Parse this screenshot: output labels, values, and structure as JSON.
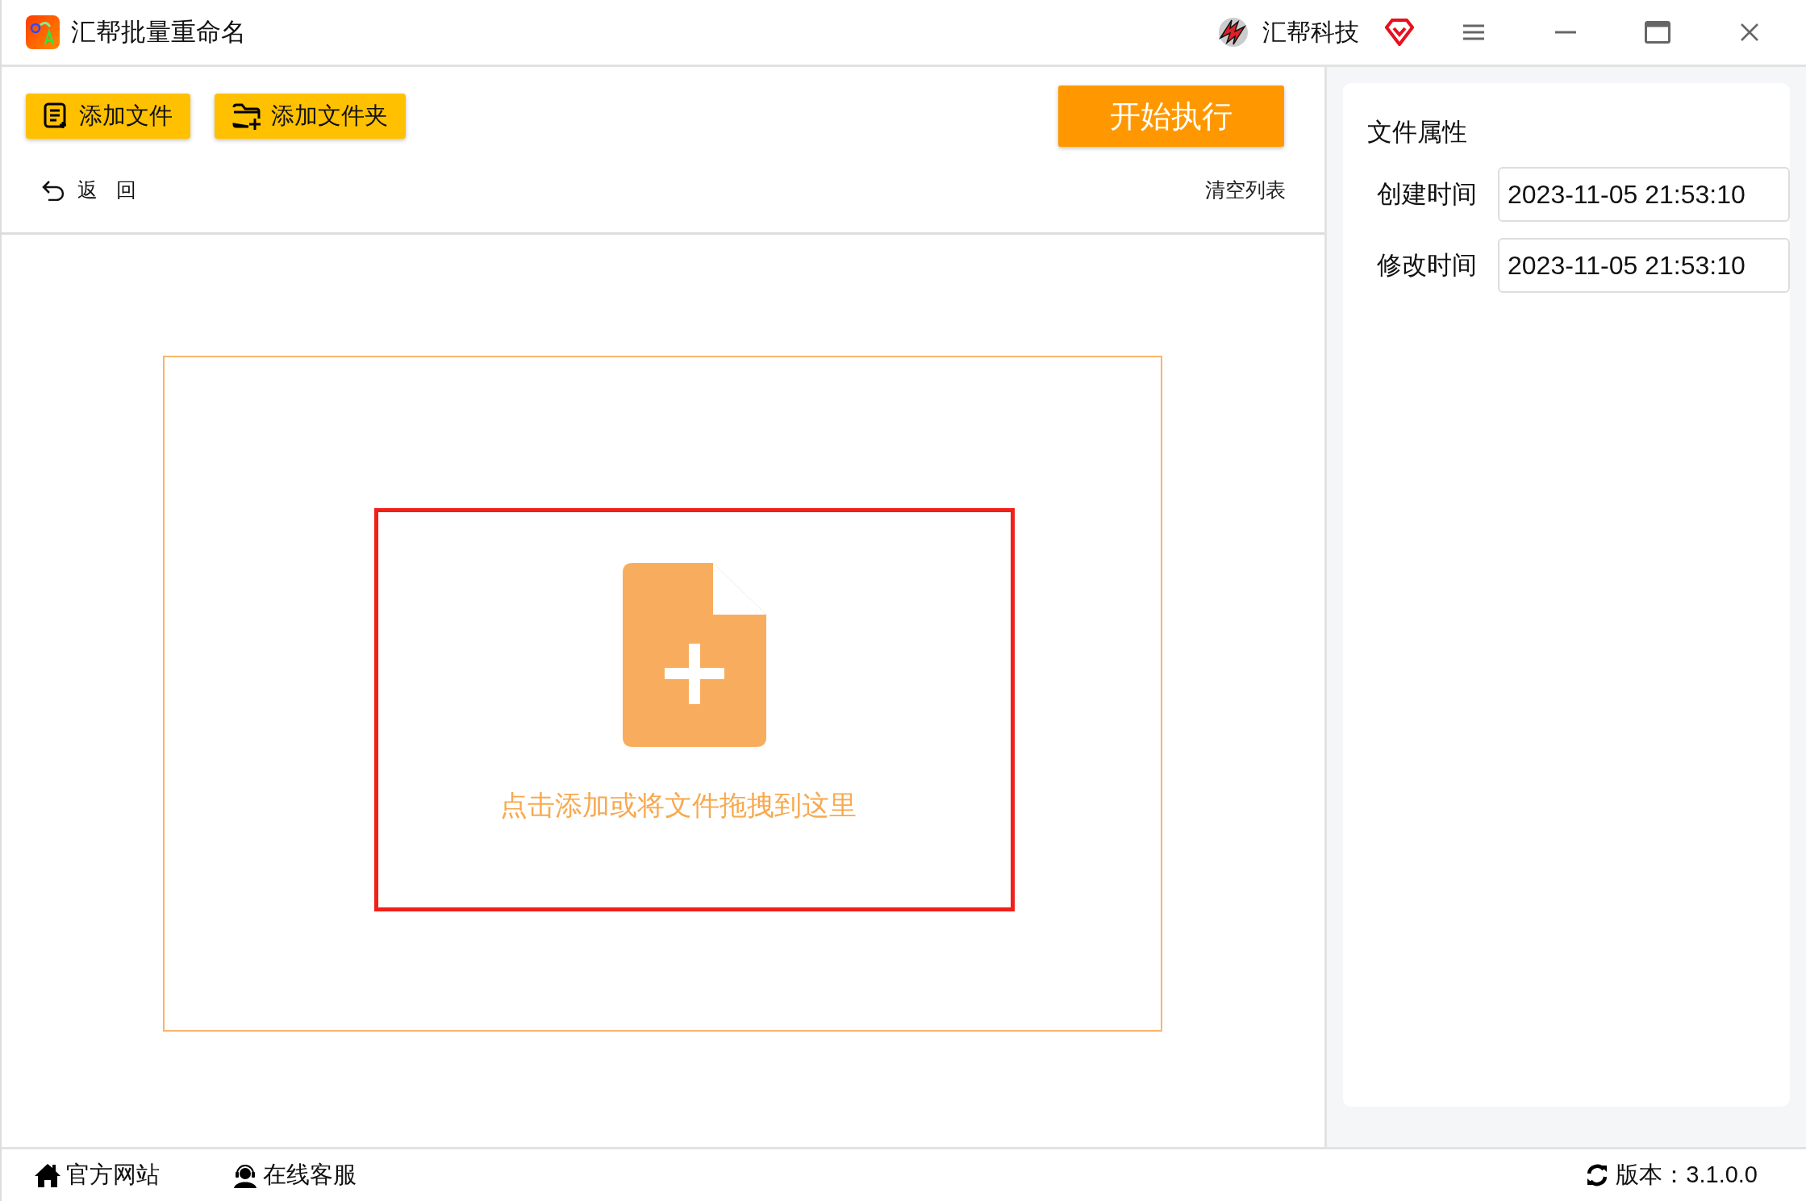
{
  "window": {
    "title": "汇帮批量重命名",
    "brand": "汇帮科技"
  },
  "toolbar": {
    "buttons": [
      "添加文件",
      "添加文件夹"
    ],
    "start": "开始执行",
    "back": "返回",
    "clear": "清空列表"
  },
  "dropzone": {
    "hint": "点击添加或将文件拖拽到这里"
  },
  "properties": {
    "title": "文件属性",
    "fields": [
      {
        "label": "创建时间",
        "value": "2023-11-05 21:53:10"
      },
      {
        "label": "修改时间",
        "value": "2023-11-05 21:53:10"
      }
    ]
  },
  "footer": {
    "links": [
      {
        "kind": "home",
        "label": "官方网站"
      },
      {
        "kind": "support",
        "label": "在线客服"
      }
    ],
    "version": "版本：3.1.0.0"
  }
}
